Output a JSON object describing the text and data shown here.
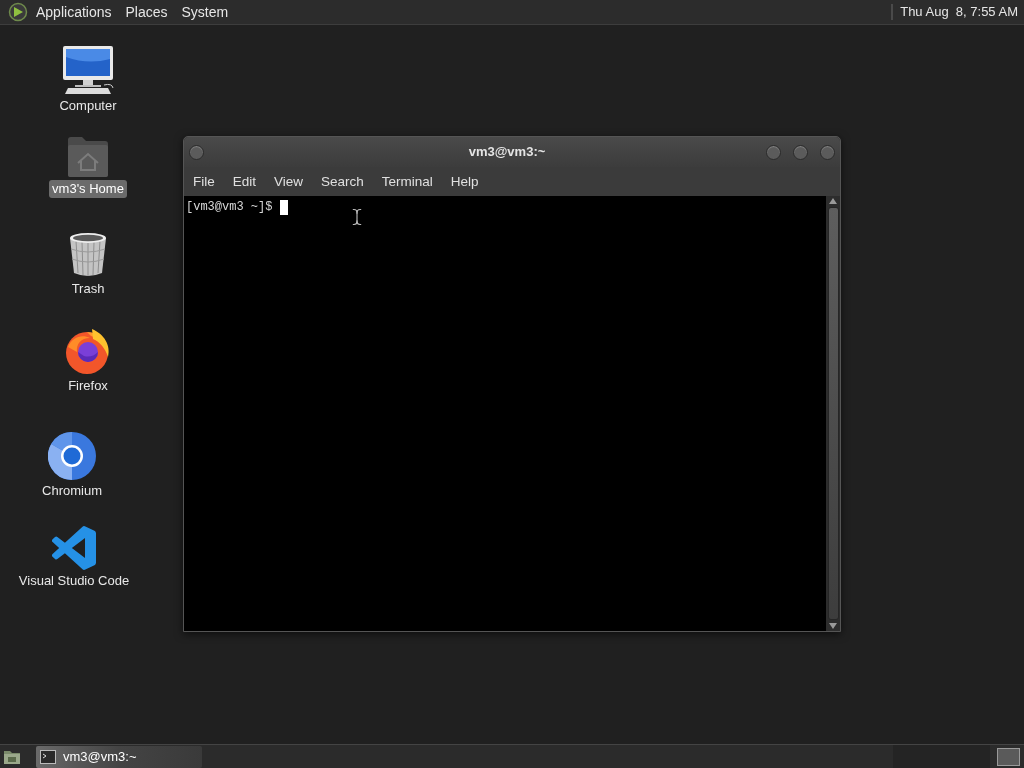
{
  "top_panel": {
    "menus": [
      "Applications",
      "Places",
      "System"
    ],
    "clock": "Thu Aug  8, 7:55 AM"
  },
  "desktop_icons": [
    {
      "kind": "computer",
      "label": "Computer",
      "selected": false
    },
    {
      "kind": "home",
      "label": "vm3's Home",
      "selected": true
    },
    {
      "kind": "trash",
      "label": "Trash",
      "selected": false
    },
    {
      "kind": "firefox",
      "label": "Firefox",
      "selected": false
    },
    {
      "kind": "chromium",
      "label": "Chromium",
      "selected": false
    },
    {
      "kind": "vscode",
      "label": "Visual Studio Code",
      "selected": false
    }
  ],
  "terminal_window": {
    "title": "vm3@vm3:~",
    "menu": [
      "File",
      "Edit",
      "View",
      "Search",
      "Terminal",
      "Help"
    ],
    "prompt": "[vm3@vm3 ~]$"
  },
  "taskbar": {
    "tasks": [
      {
        "label": "vm3@vm3:~",
        "selected": true
      }
    ]
  }
}
